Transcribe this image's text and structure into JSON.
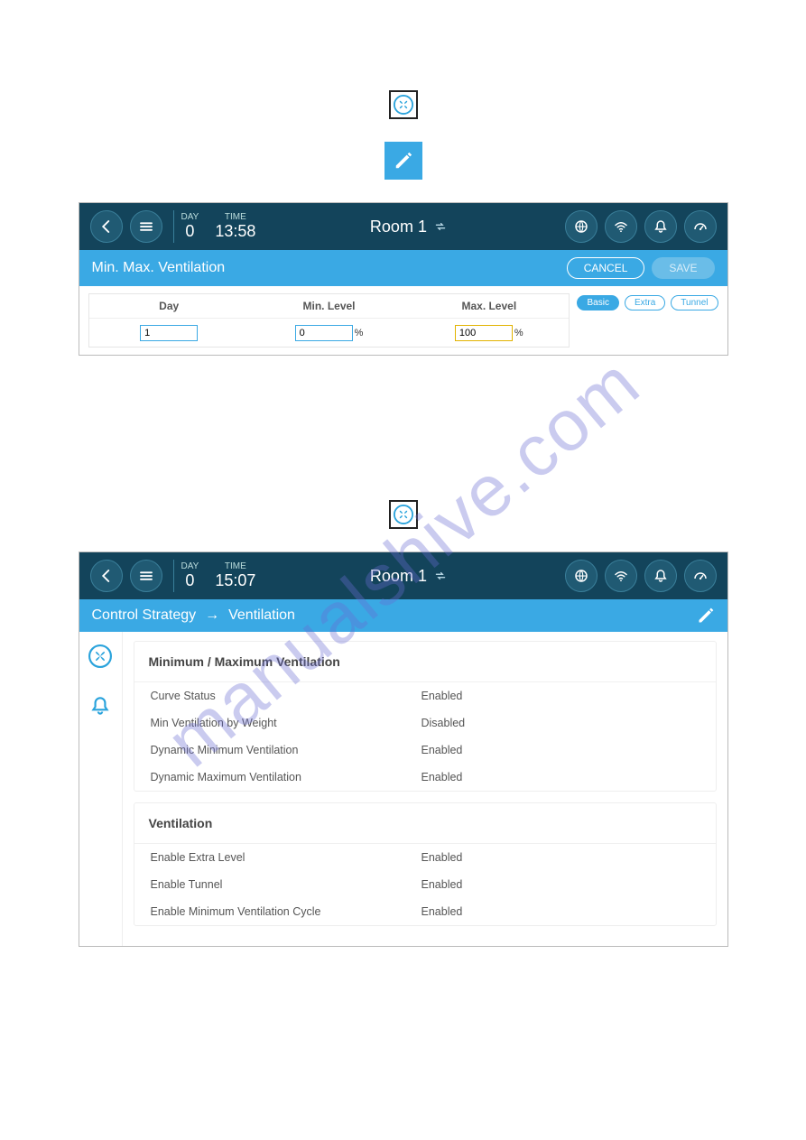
{
  "watermark": "manualshive.com",
  "screenshot1": {
    "header": {
      "day_label": "DAY",
      "day_value": "0",
      "time_label": "TIME",
      "time_value": "13:58",
      "room": "Room 1"
    },
    "subbar": {
      "title": "Min. Max. Ventilation",
      "cancel": "CANCEL",
      "save": "SAVE"
    },
    "filters": {
      "basic": "Basic",
      "extra": "Extra",
      "tunnel": "Tunnel"
    },
    "table": {
      "col_day": "Day",
      "col_min": "Min. Level",
      "col_max": "Max. Level",
      "row": {
        "day": "1",
        "min": "0",
        "min_unit": "%",
        "max": "100",
        "max_unit": "%"
      }
    }
  },
  "screenshot2": {
    "header": {
      "day_label": "DAY",
      "day_value": "0",
      "time_label": "TIME",
      "time_value": "15:07",
      "room": "Room 1"
    },
    "subbar": {
      "crumb1": "Control Strategy",
      "crumb2": "Ventilation"
    },
    "card1": {
      "title": "Minimum / Maximum Ventilation",
      "rows": [
        {
          "k": "Curve Status",
          "v": "Enabled"
        },
        {
          "k": "Min Ventilation by Weight",
          "v": "Disabled"
        },
        {
          "k": "Dynamic Minimum Ventilation",
          "v": "Enabled"
        },
        {
          "k": "Dynamic Maximum Ventilation",
          "v": "Enabled"
        }
      ]
    },
    "card2": {
      "title": "Ventilation",
      "rows": [
        {
          "k": "Enable Extra Level",
          "v": "Enabled"
        },
        {
          "k": "Enable Tunnel",
          "v": "Enabled"
        },
        {
          "k": "Enable Minimum Ventilation Cycle",
          "v": "Enabled"
        }
      ]
    }
  }
}
